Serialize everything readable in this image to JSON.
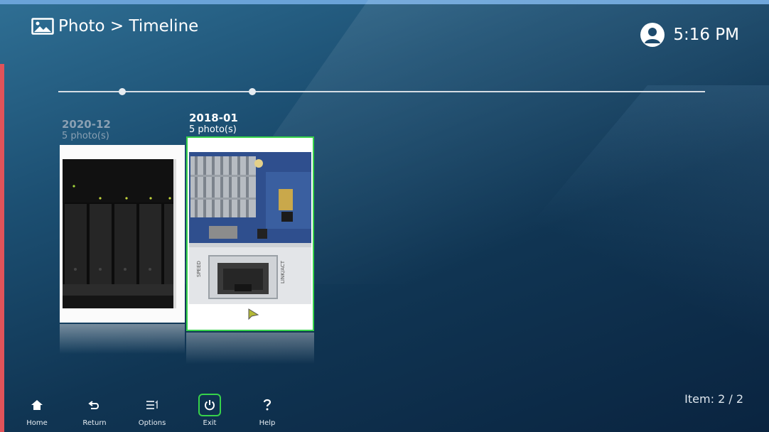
{
  "header": {
    "breadcrumb": "Photo > Timeline",
    "photo_icon": "photo-icon",
    "user_icon": "user-avatar-icon",
    "time": "5:16 PM"
  },
  "albums": [
    {
      "date": "2020-12",
      "count": "5 photo(s)",
      "selected": false
    },
    {
      "date": "2018-01",
      "count": "5 photo(s)",
      "selected": true
    }
  ],
  "status": {
    "item_counter": "Item: 2 / 2"
  },
  "toolbar": {
    "home": {
      "label": "Home",
      "icon": "home-icon"
    },
    "return": {
      "label": "Return",
      "icon": "return-icon"
    },
    "options": {
      "label": "Options",
      "icon": "options-icon"
    },
    "exit": {
      "label": "Exit",
      "icon": "power-icon",
      "focused": true
    },
    "help": {
      "label": "Help",
      "icon": "help-icon"
    }
  },
  "thumbnail_text": {
    "port_left": "SPEED",
    "port_right": "LINK/ACT"
  },
  "colors": {
    "focus_green": "#37d24a",
    "background_dark": "#0a2440",
    "background_light": "#2f6f94"
  }
}
